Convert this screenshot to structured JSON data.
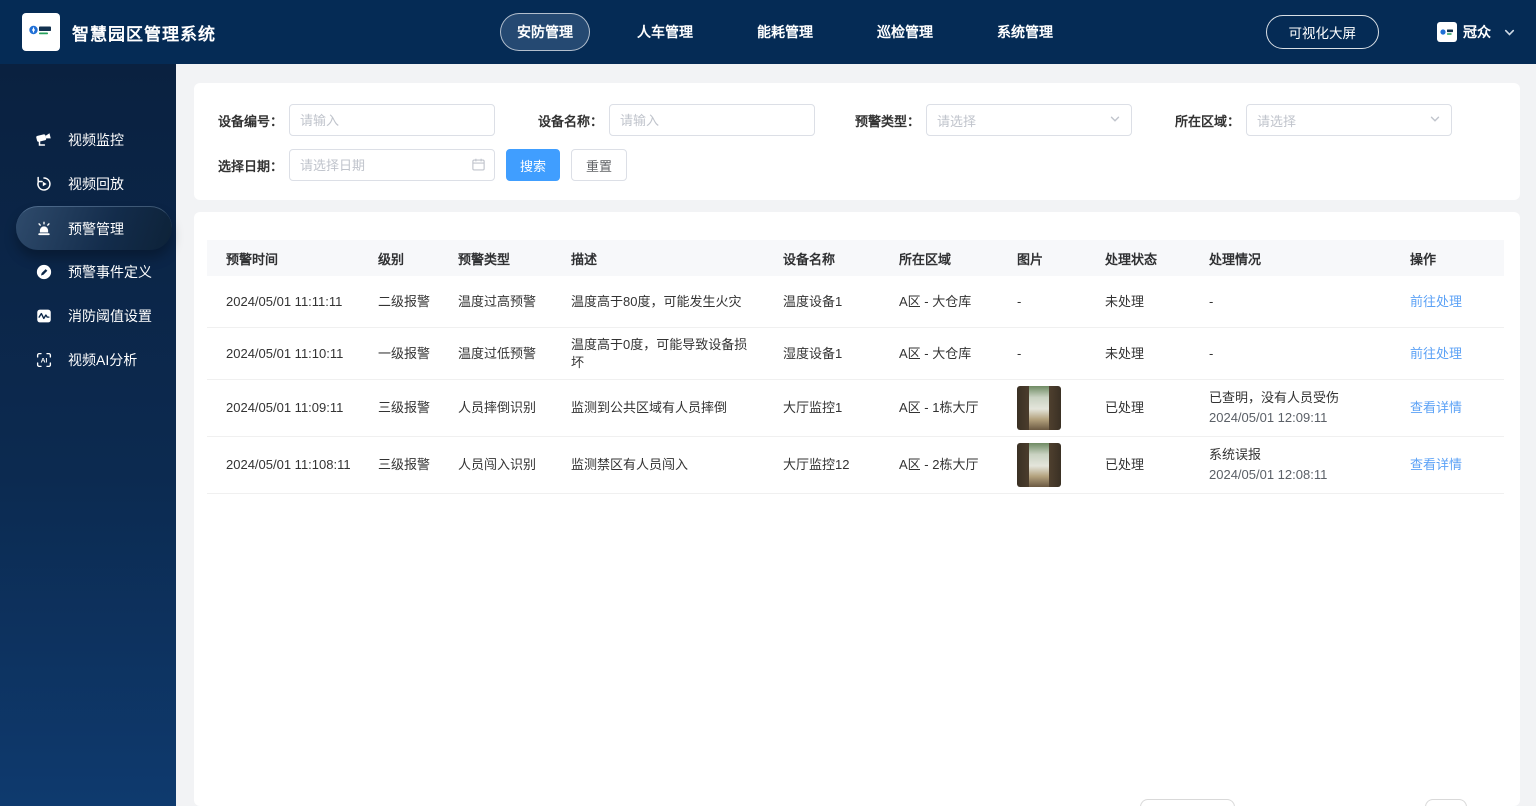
{
  "navbar": {
    "title": "智慧园区管理系统",
    "items": [
      {
        "label": "安防管理",
        "active": true
      },
      {
        "label": "人车管理",
        "active": false
      },
      {
        "label": "能耗管理",
        "active": false
      },
      {
        "label": "巡检管理",
        "active": false
      },
      {
        "label": "系统管理",
        "active": false
      }
    ],
    "big_screen_button": "可视化大屏",
    "username": "冠众"
  },
  "sidebar": {
    "items": [
      {
        "label": "视频监控",
        "icon": "camera-icon",
        "active": false
      },
      {
        "label": "视频回放",
        "icon": "playback-icon",
        "active": false
      },
      {
        "label": "预警管理",
        "icon": "alarm-icon",
        "active": true
      },
      {
        "label": "预警事件定义",
        "icon": "event-definition-icon",
        "active": false
      },
      {
        "label": "消防阈值设置",
        "icon": "threshold-icon",
        "active": false
      },
      {
        "label": "视频AI分析",
        "icon": "ai-analysis-icon",
        "active": false
      }
    ]
  },
  "filters": {
    "device_code_label": "设备编号：",
    "device_code_placeholder": "请输入",
    "device_name_label": "设备名称：",
    "device_name_placeholder": "请输入",
    "alert_type_label": "预警类型：",
    "alert_type_placeholder": "请选择",
    "area_label": "所在区域：",
    "area_placeholder": "请选择",
    "date_label": "选择日期：",
    "date_placeholder": "请选择日期",
    "search_button": "搜索",
    "reset_button": "重置"
  },
  "table": {
    "headers": [
      "预警时间",
      "级别",
      "预警类型",
      "描述",
      "设备名称",
      "所在区域",
      "图片",
      "处理状态",
      "处理情况",
      "操作"
    ],
    "rows": [
      {
        "time": "2024/05/01 11:11:11",
        "level": "二级报警",
        "type": "温度过高预警",
        "desc": "温度高于80度，可能发生火灾",
        "device": "温度设备1",
        "area": "A区 - 大仓库",
        "has_image": false,
        "image_placeholder": "-",
        "status": "未处理",
        "handling": "-",
        "handling_time": "",
        "action": "前往处理"
      },
      {
        "time": "2024/05/01 11:10:11",
        "level": "一级报警",
        "type": "温度过低预警",
        "desc": "温度高于0度，可能导致设备损坏",
        "device": "湿度设备1",
        "area": "A区 - 大仓库",
        "has_image": false,
        "image_placeholder": "-",
        "status": "未处理",
        "handling": "-",
        "handling_time": "",
        "action": "前往处理"
      },
      {
        "time": "2024/05/01 11:09:11",
        "level": "三级报警",
        "type": "人员摔倒识别",
        "desc": "监测到公共区域有人员摔倒",
        "device": "大厅监控1",
        "area": "A区 - 1栋大厅",
        "has_image": true,
        "image_placeholder": "",
        "status": "已处理",
        "handling": "已查明，没有人员受伤",
        "handling_time": "2024/05/01 12:09:11",
        "action": "查看详情"
      },
      {
        "time": "2024/05/01 11:108:11",
        "level": "三级报警",
        "type": "人员闯入识别",
        "desc": "监测禁区有人员闯入",
        "device": "大厅监控12",
        "area": "A区 - 2栋大厅",
        "has_image": true,
        "image_placeholder": "",
        "status": "已处理",
        "handling": "系统误报",
        "handling_time": "2024/05/01 12:08:11",
        "action": "查看详情"
      }
    ]
  },
  "colors": {
    "navbar_navy": "#052b55",
    "sidebar_gradient_top": "#0a2140",
    "sidebar_gradient_bottom": "#0e3a6e",
    "accent_blue": "#409eff",
    "link_blue": "#5ca2f6"
  }
}
